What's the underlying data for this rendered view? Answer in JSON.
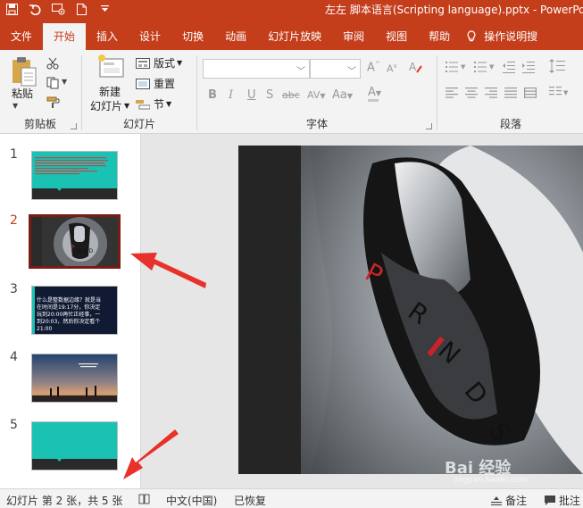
{
  "window": {
    "title": "左左 脚本语言(Scripting language).pptx  -  PowerPo"
  },
  "qat": {
    "save_icon": "save-icon",
    "undo_icon": "undo-icon",
    "present_icon": "present-from-beginning-icon",
    "new_icon": "new-file-icon",
    "more_icon": "customize-qat-icon"
  },
  "tabs": [
    {
      "label": "文件",
      "active": false
    },
    {
      "label": "开始",
      "active": true
    },
    {
      "label": "插入",
      "active": false
    },
    {
      "label": "设计",
      "active": false
    },
    {
      "label": "切换",
      "active": false
    },
    {
      "label": "动画",
      "active": false
    },
    {
      "label": "幻灯片放映",
      "active": false
    },
    {
      "label": "审阅",
      "active": false
    },
    {
      "label": "视图",
      "active": false
    },
    {
      "label": "帮助",
      "active": false
    }
  ],
  "help_search": "操作说明搜",
  "ribbon": {
    "clipboard": {
      "paste_label": "粘贴",
      "group_label": "剪贴板"
    },
    "slides": {
      "new_slide_label_1": "新建",
      "new_slide_label_2": "幻灯片",
      "layout_label": "版式",
      "reset_label": "重置",
      "section_label": "节",
      "group_label": "幻灯片"
    },
    "font": {
      "group_label": "字体",
      "bold": "B",
      "italic": "I",
      "underline": "U",
      "shadow": "S",
      "strike": "abc",
      "spacing": "AV",
      "case": "Aa",
      "color": "A",
      "grow": "A",
      "shrink": "A"
    },
    "paragraph": {
      "group_label": "段落"
    }
  },
  "thumbnails": [
    {
      "number": "1",
      "selected": false
    },
    {
      "number": "2",
      "selected": true
    },
    {
      "number": "3",
      "selected": false,
      "text": "什么是整数据边缘？就是当\n在时间是19:17分，你决定\n玩到20:00再忙正经事，一\n到20:03，然后你决定看个\n21:00"
    },
    {
      "number": "4",
      "selected": false
    },
    {
      "number": "5",
      "selected": false
    }
  ],
  "slide_shift_letters": [
    "P",
    "R",
    "N",
    "D",
    "S"
  ],
  "status": {
    "slide_info": "幻灯片 第 2 张，共 5 张",
    "language": "中文(中国)",
    "recovered": "已恢复",
    "notes": "备注",
    "comments": "批注"
  },
  "watermark": {
    "text": "Bai 经验",
    "url": "jingyan.baidu.com"
  },
  "colors": {
    "accent": "#c43e1c",
    "teal": "#19c2b3",
    "selected_border": "#7a1b14",
    "arrow": "#e8312a"
  }
}
